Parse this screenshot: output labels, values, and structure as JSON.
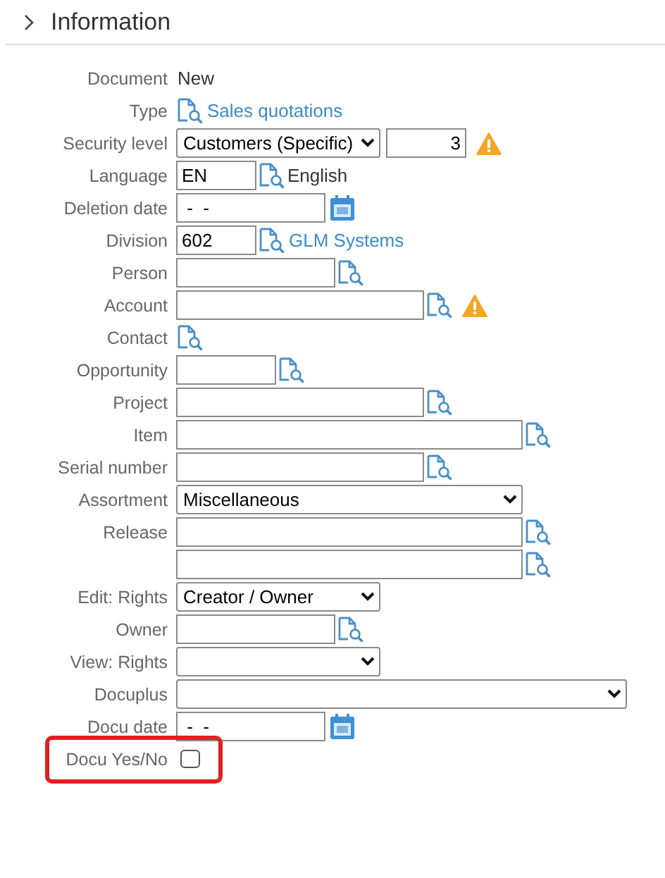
{
  "section": {
    "title": "Information",
    "expanded": false
  },
  "rows": [
    {
      "label": "Document",
      "parts": [
        {
          "kind": "text",
          "text": "New"
        }
      ]
    },
    {
      "label": "Type",
      "parts": [
        {
          "kind": "lookup"
        },
        {
          "kind": "link",
          "text": "Sales quotations"
        }
      ]
    },
    {
      "label": "Security level",
      "parts": [
        {
          "kind": "select",
          "value": "Customers (Specific)"
        },
        {
          "kind": "input",
          "value": "3"
        },
        {
          "kind": "warning"
        }
      ]
    },
    {
      "label": "Language",
      "parts": [
        {
          "kind": "input",
          "value": "EN"
        },
        {
          "kind": "lookup"
        },
        {
          "kind": "text",
          "text": "English"
        }
      ]
    },
    {
      "label": "Deletion date",
      "parts": [
        {
          "kind": "input",
          "value": " -  -"
        },
        {
          "kind": "calendar"
        }
      ]
    },
    {
      "label": "Division",
      "parts": [
        {
          "kind": "input",
          "value": "602"
        },
        {
          "kind": "lookup"
        },
        {
          "kind": "link",
          "text": "GLM Systems"
        }
      ]
    },
    {
      "label": "Person",
      "parts": [
        {
          "kind": "input"
        },
        {
          "kind": "lookup"
        }
      ]
    },
    {
      "label": "Account",
      "parts": [
        {
          "kind": "input"
        },
        {
          "kind": "lookup"
        },
        {
          "kind": "warning"
        }
      ]
    },
    {
      "label": "Contact",
      "parts": [
        {
          "kind": "lookup"
        }
      ]
    },
    {
      "label": "Opportunity",
      "parts": [
        {
          "kind": "input"
        },
        {
          "kind": "lookup"
        }
      ]
    },
    {
      "label": "Project",
      "parts": [
        {
          "kind": "input"
        },
        {
          "kind": "lookup"
        }
      ]
    },
    {
      "label": "Item",
      "parts": [
        {
          "kind": "input"
        },
        {
          "kind": "lookup"
        }
      ]
    },
    {
      "label": "Serial number",
      "parts": [
        {
          "kind": "input"
        },
        {
          "kind": "lookup"
        }
      ]
    },
    {
      "label": "Assortment",
      "parts": [
        {
          "kind": "select",
          "value": "Miscellaneous"
        }
      ]
    },
    {
      "label": "Release",
      "parts": [
        {
          "kind": "input"
        },
        {
          "kind": "lookup"
        }
      ]
    },
    {
      "parts": [
        {
          "kind": "input"
        },
        {
          "kind": "lookup"
        }
      ]
    },
    {
      "label": "Edit: Rights",
      "parts": [
        {
          "kind": "select",
          "value": "Creator / Owner"
        }
      ]
    },
    {
      "label": "Owner",
      "parts": [
        {
          "kind": "input"
        },
        {
          "kind": "lookup"
        }
      ]
    },
    {
      "label": "View: Rights",
      "parts": [
        {
          "kind": "select"
        }
      ]
    },
    {
      "label": "Docuplus",
      "parts": [
        {
          "kind": "select"
        }
      ]
    },
    {
      "label": "Docu date",
      "parts": [
        {
          "kind": "input",
          "value": " -  -"
        },
        {
          "kind": "calendar"
        }
      ]
    },
    {
      "label": "Docu Yes/No",
      "highlighted": true,
      "parts": [
        {
          "kind": "checkbox",
          "checked": false
        }
      ]
    }
  ]
}
